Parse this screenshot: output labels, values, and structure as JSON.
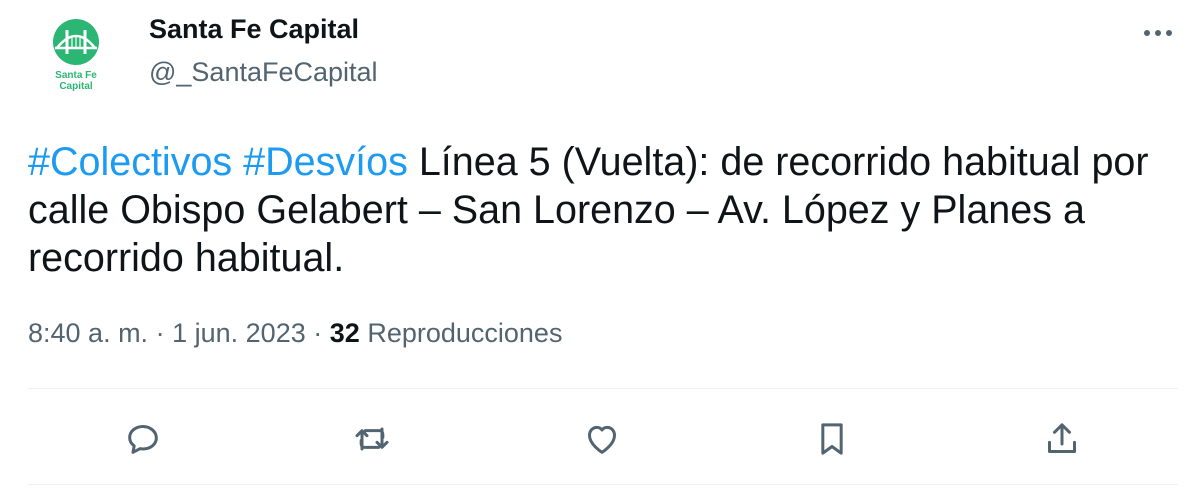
{
  "author": {
    "name": "Santa Fe Capital",
    "handle": "@_SantaFeCapital",
    "avatar_text_line1": "Santa Fe",
    "avatar_text_line2": "Capital",
    "avatar_color": "#2bb673"
  },
  "tweet": {
    "hashtag1": "#Colectivos",
    "hashtag2": "#Desvíos",
    "body": "Línea 5 (Vuelta): de recorrido habitual por calle Obispo Gelabert – San Lorenzo – Av. López y Planes a recorrido habitual."
  },
  "meta": {
    "time": "8:40 a. m.",
    "sep1": "·",
    "date": "1 jun. 2023",
    "sep2": "·",
    "views_count": "32",
    "views_label": "Reproducciones"
  },
  "actions": {
    "reply_icon": "comment-icon",
    "retweet_icon": "retweet-icon",
    "like_icon": "heart-icon",
    "bookmark_icon": "bookmark-icon",
    "share_icon": "share-icon"
  },
  "colors": {
    "link": "#1d9bf0",
    "secondary_text": "#536471",
    "icon": "#536471"
  }
}
